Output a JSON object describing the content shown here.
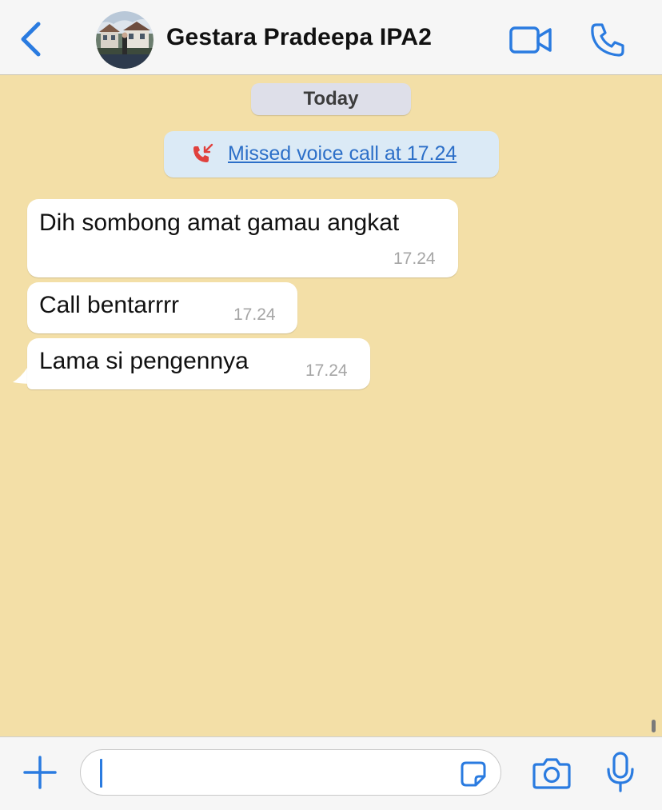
{
  "header": {
    "back_icon": "chevron-left-icon",
    "contact_name": "Gestara Pradeepa IPA2",
    "avatar_icon": "contact-avatar-photo",
    "video_icon": "video-camera-icon",
    "call_icon": "phone-icon"
  },
  "chat": {
    "date_label": "Today",
    "missed_call": {
      "icon": "missed-call-icon",
      "text": "Missed voice call at 17.24"
    },
    "messages": [
      {
        "text": "Dih sombong amat gamau angkat",
        "time": "17.24"
      },
      {
        "text": "Call bentarrrr",
        "time": "17.24"
      },
      {
        "text": "Lama si pengennya",
        "time": "17.24"
      }
    ]
  },
  "input_bar": {
    "plus_icon": "plus-icon",
    "message_value": "",
    "sticker_icon": "sticker-icon",
    "camera_icon": "camera-icon",
    "mic_icon": "microphone-icon"
  },
  "colors": {
    "wallpaper": "#f3dfa7",
    "accent_blue": "#2a7be0",
    "missed_call_red": "#e0413d",
    "bubble_incoming": "#ffffff",
    "bar_background": "#f6f6f6"
  }
}
